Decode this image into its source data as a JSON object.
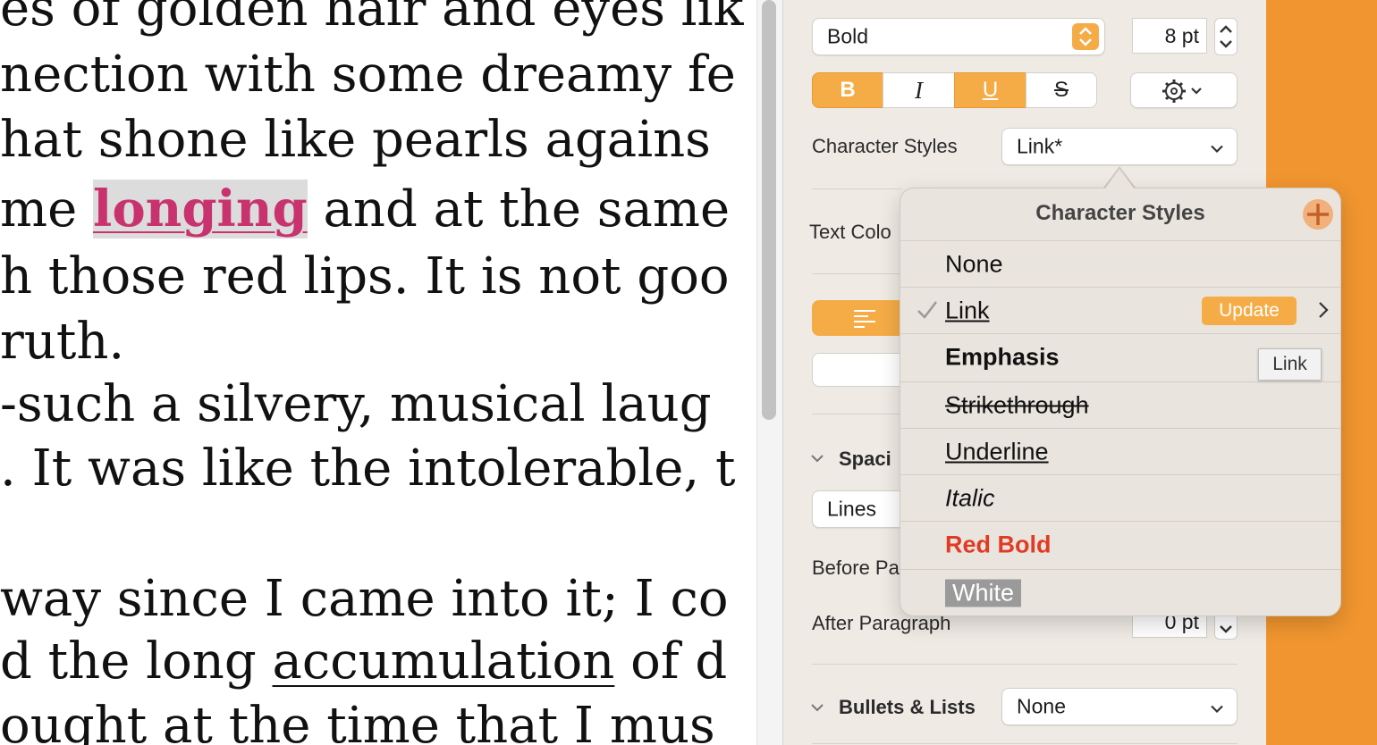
{
  "document": {
    "lines": [
      {
        "text": "es of golden hair and eyes lik"
      },
      {
        "text": "nection with some dreamy fe"
      },
      {
        "text": "hat shone like pearls agains"
      },
      {
        "before": "me ",
        "highlight": "longing",
        "after": " and at the same"
      },
      {
        "text": "h those red lips. It is not goo"
      },
      {
        "text": "ruth."
      },
      {
        "text": "-such a silvery, musical laug"
      },
      {
        "text": ". It was like the intolerable, t"
      },
      {
        "text": " way since I came into it; I co"
      },
      {
        "before": "d the long ",
        "underline": "accumulation",
        "after": " of d"
      },
      {
        "text": "ought at the time that I mus"
      }
    ]
  },
  "inspector": {
    "font_style": "Bold",
    "font_size": "8 pt",
    "format_buttons": {
      "bold": "B",
      "italic": "I",
      "underline": "U",
      "strike": "S"
    },
    "character_styles_label": "Character Styles",
    "character_styles_value": "Link*",
    "text_color_label": "Text Colo",
    "spacing_label": "Spaci",
    "spacing_value": "Lines",
    "before_paragraph_label": "Before Pa",
    "after_paragraph_label": "After Paragraph",
    "after_paragraph_value": "0 pt",
    "bullets_label": "Bullets & Lists",
    "bullets_value": "None"
  },
  "popover": {
    "title": "Character Styles",
    "items": [
      {
        "label": "None"
      },
      {
        "label": "Link",
        "selected": true,
        "update_label": "Update"
      },
      {
        "label": "Emphasis"
      },
      {
        "label": "Strikethrough"
      },
      {
        "label": "Underline"
      },
      {
        "label": "Italic"
      },
      {
        "label": "Red Bold"
      },
      {
        "label": "White"
      }
    ],
    "tooltip": "Link"
  },
  "colors": {
    "accent_orange": "#f5ac47",
    "link_pink": "#c8336f",
    "red_bold": "#e03b24",
    "desktop_orange": "#f0952f"
  }
}
